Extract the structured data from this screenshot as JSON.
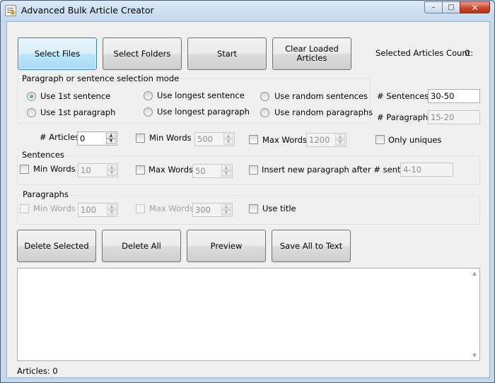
{
  "window": {
    "title": "Advanced Bulk Article Creator",
    "app_icon": "document-icon",
    "controls": {
      "minimize": "–",
      "maximize": "□",
      "close": "✕"
    }
  },
  "top_buttons": {
    "select_files": "Select Files",
    "select_folders": "Select Folders",
    "start": "Start",
    "clear_line1": "Clear Loaded",
    "clear_line2": "Articles"
  },
  "selected_count": {
    "label": "Selected Articles Count:",
    "value": "0"
  },
  "selection_mode": {
    "title": "Paragraph or sentence selection mode",
    "options": [
      {
        "label": "Use 1st sentence",
        "checked": true
      },
      {
        "label": "Use longest sentence",
        "checked": false
      },
      {
        "label": "Use random sentences",
        "checked": false
      },
      {
        "label": "Use 1st paragraph",
        "checked": false
      },
      {
        "label": "Use longest paragraph",
        "checked": false
      },
      {
        "label": "Use random paragraphs",
        "checked": false
      }
    ]
  },
  "sentences_count": {
    "label": "# Sentences",
    "value": "30-50"
  },
  "paragraphs_count": {
    "label": "# Paragraphs",
    "value": "15-20"
  },
  "articles": {
    "label": "# Articles",
    "value": "0"
  },
  "min_words": {
    "label": "Min Words",
    "value": "500"
  },
  "max_words": {
    "label": "Max Words",
    "value": "1200"
  },
  "only_uniques": {
    "label": "Only uniques"
  },
  "sentences_group": {
    "title": "Sentences",
    "min_words_label": "Min Words",
    "min_words_value": "10",
    "max_words_label": "Max Words",
    "max_words_value": "50",
    "insert_label": "Insert new paragraph after # sentences",
    "insert_value": "4-10"
  },
  "paragraphs_group": {
    "title": "Paragraphs",
    "min_words_label": "Min Words",
    "min_words_value": "100",
    "max_words_label": "Max Words",
    "max_words_value": "300",
    "use_title_label": "Use title"
  },
  "bottom_buttons": {
    "delete_selected": "Delete Selected",
    "delete_all": "Delete All",
    "preview": "Preview",
    "save_all": "Save All to Text"
  },
  "status": {
    "articles": "Articles: 0"
  }
}
